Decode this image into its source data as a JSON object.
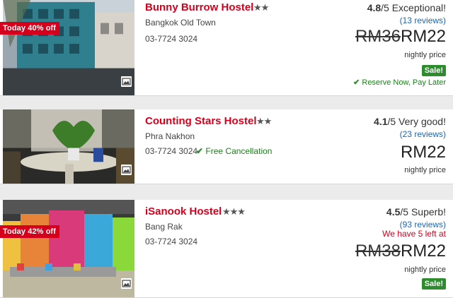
{
  "hostels": [
    {
      "name": "Bunny Burrow Hostel",
      "stars": "★★",
      "star_count": 2,
      "district": "Bangkok Old Town",
      "phone": "03-7724 3024",
      "deal_badge": "Today 40% off",
      "rating_score": "4.8",
      "rating_rest": "/5 Exceptional!",
      "reviews": "(13 reviews)",
      "price_old": "RM36",
      "price": "RM22",
      "price_note": "nightly price",
      "sale_badge": "Sale!",
      "reserve_note": "Reserve Now, Pay Later"
    },
    {
      "name": "Counting Stars Hostel",
      "stars": "★★",
      "star_count": 2,
      "district": "Phra Nakhon",
      "phone": "03-7724 3024",
      "free_cancellation": "Free Cancellation",
      "rating_score": "4.1",
      "rating_rest": "/5 Very good!",
      "reviews": "(23 reviews)",
      "price": "RM22",
      "price_note": "nightly price"
    },
    {
      "name": "iSanook Hostel",
      "stars": "★★★",
      "star_count": 3,
      "district": "Bang Rak",
      "phone": "03-7724 3024",
      "deal_badge": "Today 42% off",
      "rating_score": "4.5",
      "rating_rest": "/5 Superb!",
      "reviews": "(93 reviews)",
      "availability_warning": "We have 5 left at",
      "price_old": "RM38",
      "price": "RM22",
      "price_note": "nightly price",
      "sale_badge": "Sale!"
    }
  ],
  "icons": {
    "gallery": "photo-gallery-icon",
    "check": "check-icon"
  },
  "colors": {
    "brand_red": "#d4001c",
    "link_blue": "#2266aa",
    "sale_green": "#2e8b2e"
  }
}
